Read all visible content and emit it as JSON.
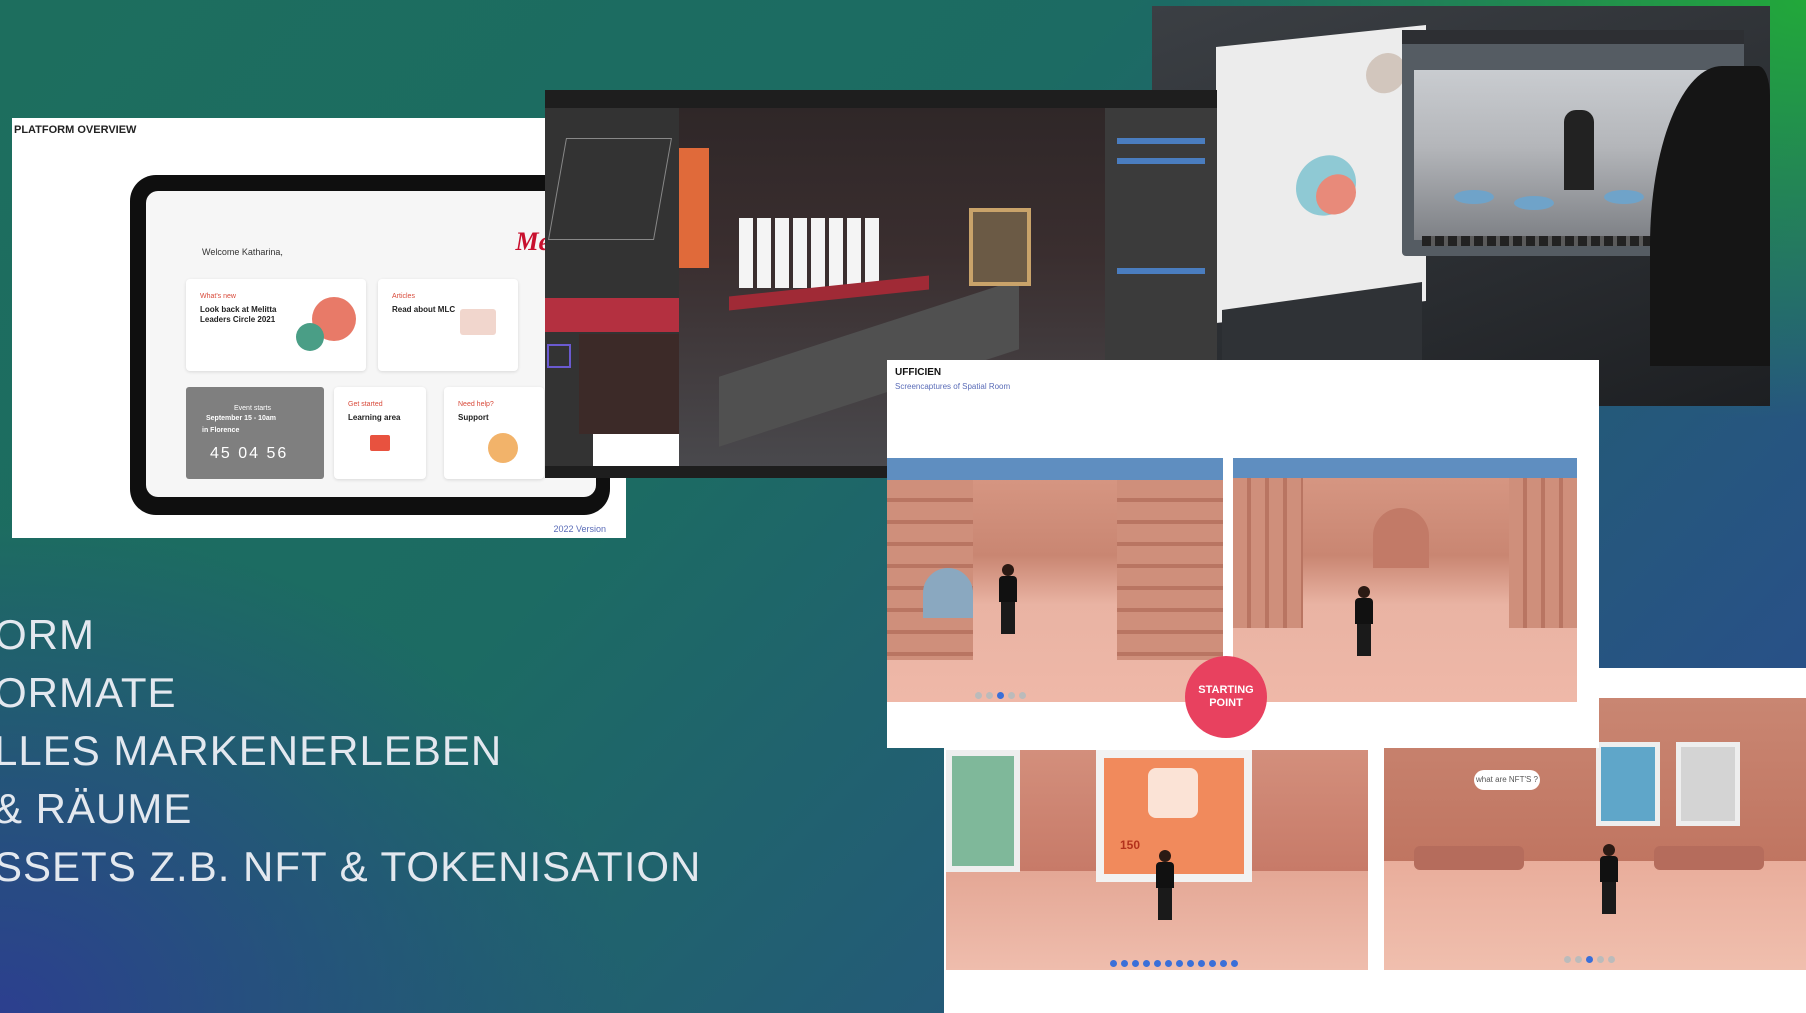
{
  "platform_card": {
    "title": "PLATFORM OVERVIEW",
    "version": "2022 Version",
    "welcome": "Welcome Katharina,",
    "logo": "Melitta",
    "tiles": [
      {
        "kicker": "What's new",
        "heading": "Look back at Melitta Leaders Circle 2021"
      },
      {
        "kicker": "Articles",
        "heading": "Read about MLC"
      },
      {
        "kicker": "Get started",
        "heading": "Learning area"
      },
      {
        "kicker": "Need help?",
        "heading": "Support"
      }
    ],
    "event": {
      "starts": "Event starts",
      "date": "September 15 - 10am",
      "place": "in Florence",
      "countdown": "45  04  56"
    }
  },
  "ufficien_card": {
    "title": "UFFICIEN",
    "subtitle": "Screencaptures of Spatial Room",
    "badge_line1": "STARTING",
    "badge_line2": "POINT"
  },
  "gallery_card": {
    "price": "150",
    "bubble": "what are NFT'S ?"
  },
  "bullets": [
    "ORM",
    "ORMATE",
    "LLES MARKENERLEBEN",
    "& RÄUME",
    "SSETS Z.B. NFT & TOKENISATION"
  ],
  "colors": {
    "accent_red": "#e8415f",
    "melitta_red": "#c8102e",
    "link_blue": "#5a6cb8"
  }
}
